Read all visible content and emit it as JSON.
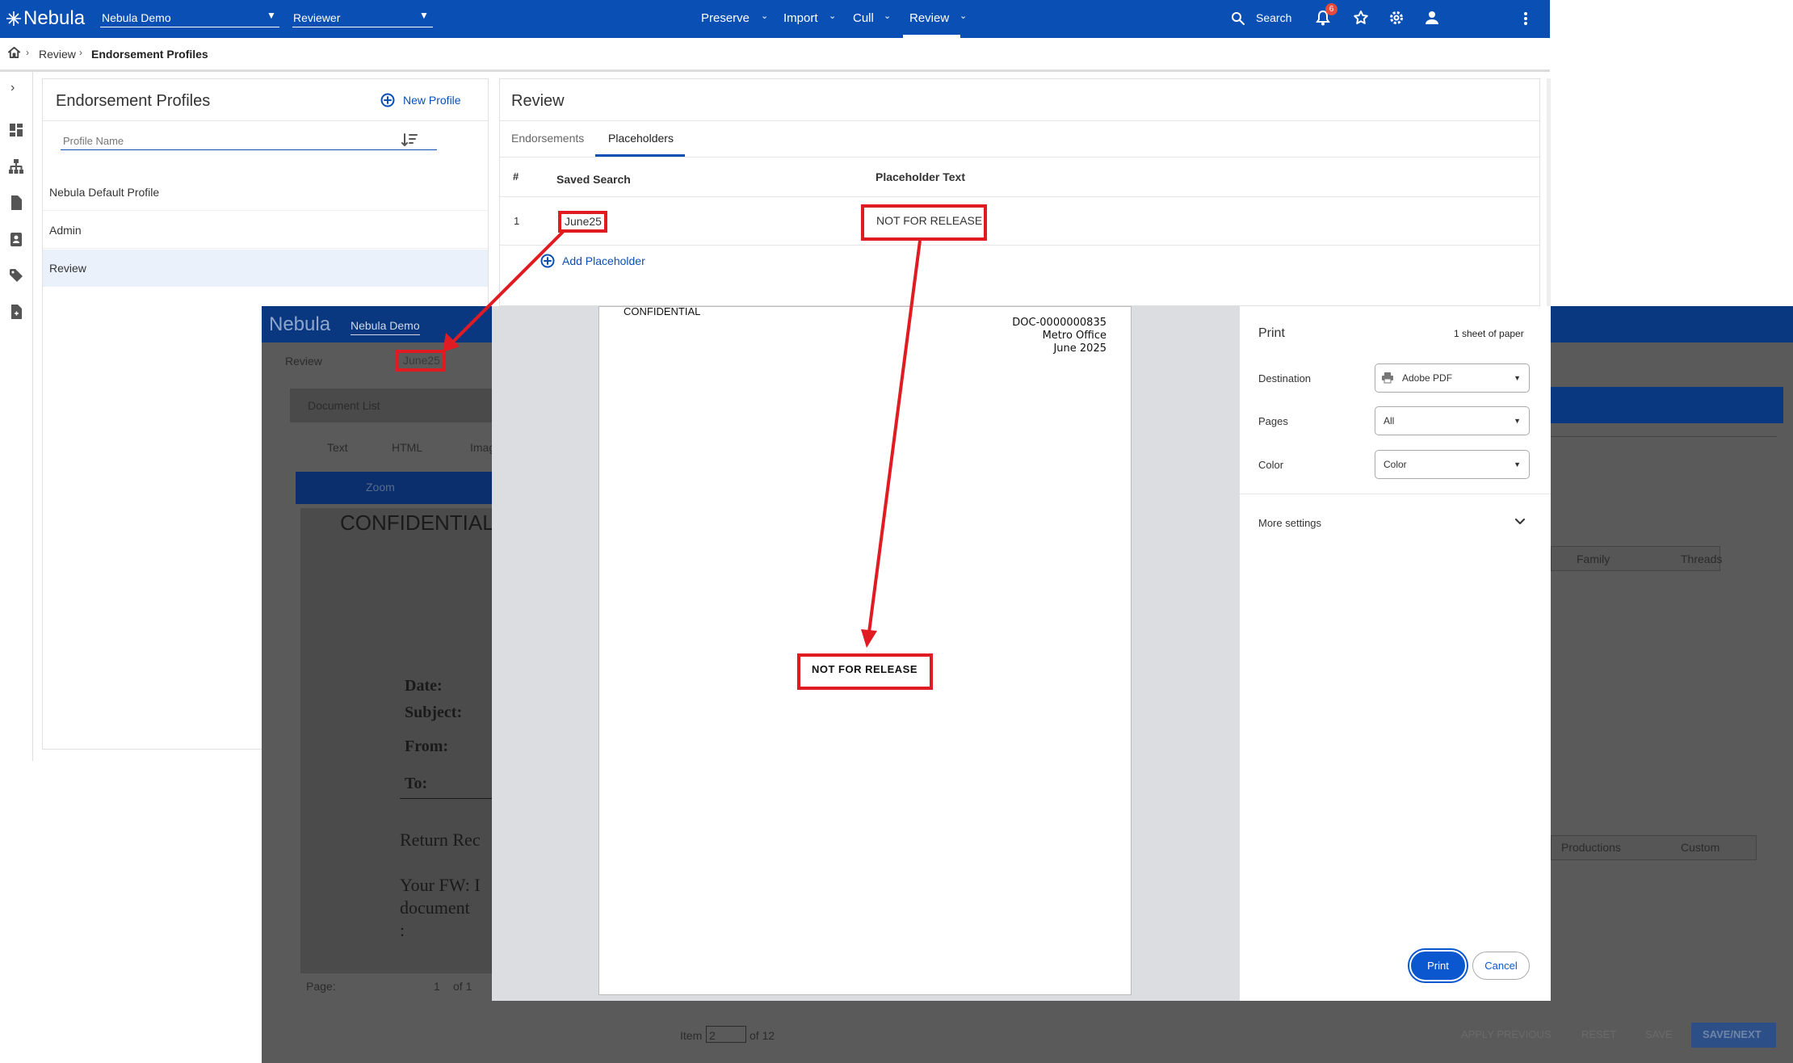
{
  "topbar": {
    "brand": "Nebula",
    "project": "Nebula Demo",
    "role": "Reviewer",
    "menus": [
      "Preserve",
      "Import",
      "Cull",
      "Review"
    ],
    "search": "Search",
    "notif_count": "6"
  },
  "breadcrumb": {
    "items": [
      "Review",
      "Endorsement Profiles"
    ]
  },
  "profiles": {
    "title": "Endorsement Profiles",
    "new_label": "New Profile",
    "filter_placeholder": "Profile Name",
    "items": [
      "Nebula Default Profile",
      "Admin",
      "Review"
    ]
  },
  "review": {
    "title": "Review",
    "tabs": [
      "Endorsements",
      "Placeholders"
    ],
    "columns": [
      "#",
      "Saved Search",
      "Placeholder Text"
    ],
    "rows": [
      {
        "num": "1",
        "search": "June25",
        "text": "NOT FOR RELEASE"
      }
    ],
    "add_label": "Add Placeholder"
  },
  "doc_view": {
    "brand": "Nebula",
    "project": "Nebula Demo",
    "crumb": [
      "Review",
      "June25"
    ],
    "tab_title": "Document List",
    "view_tabs": [
      "Text",
      "HTML",
      "Image"
    ],
    "zoom_label": "Zoom",
    "doc_heading": "CONFIDENTIAL",
    "memo": [
      "Date:",
      "Subject:",
      "From:",
      "To:"
    ],
    "body_lines": [
      "Return Rec",
      "Your FW: I",
      "document",
      ":"
    ],
    "page_label": "Page:",
    "page_num": "1",
    "page_of": "of 1",
    "item_label": "Item",
    "item_num": "2",
    "item_of": "of 12",
    "right_tabs": [
      "Family",
      "Threads"
    ],
    "right_tabs2": [
      "Productions",
      "Custom"
    ],
    "footer_buttons": [
      "APPLY PREVIOUS",
      "RESET",
      "SAVE",
      "SAVE/NEXT"
    ]
  },
  "print_preview": {
    "header_left": "CONFIDENTIAL",
    "header_right": [
      "DOC-0000000835",
      "Metro Office",
      "June 2025"
    ],
    "endorsement": "NOT FOR RELEASE"
  },
  "print": {
    "title": "Print",
    "sheets": "1 sheet of paper",
    "destination_label": "Destination",
    "destination": "Adobe PDF",
    "pages_label": "Pages",
    "pages": "All",
    "color_label": "Color",
    "color": "Color",
    "more": "More settings",
    "print_btn": "Print",
    "cancel_btn": "Cancel"
  },
  "colors": {
    "brand": "#0a4fb4",
    "highlight": "#e11b22"
  }
}
